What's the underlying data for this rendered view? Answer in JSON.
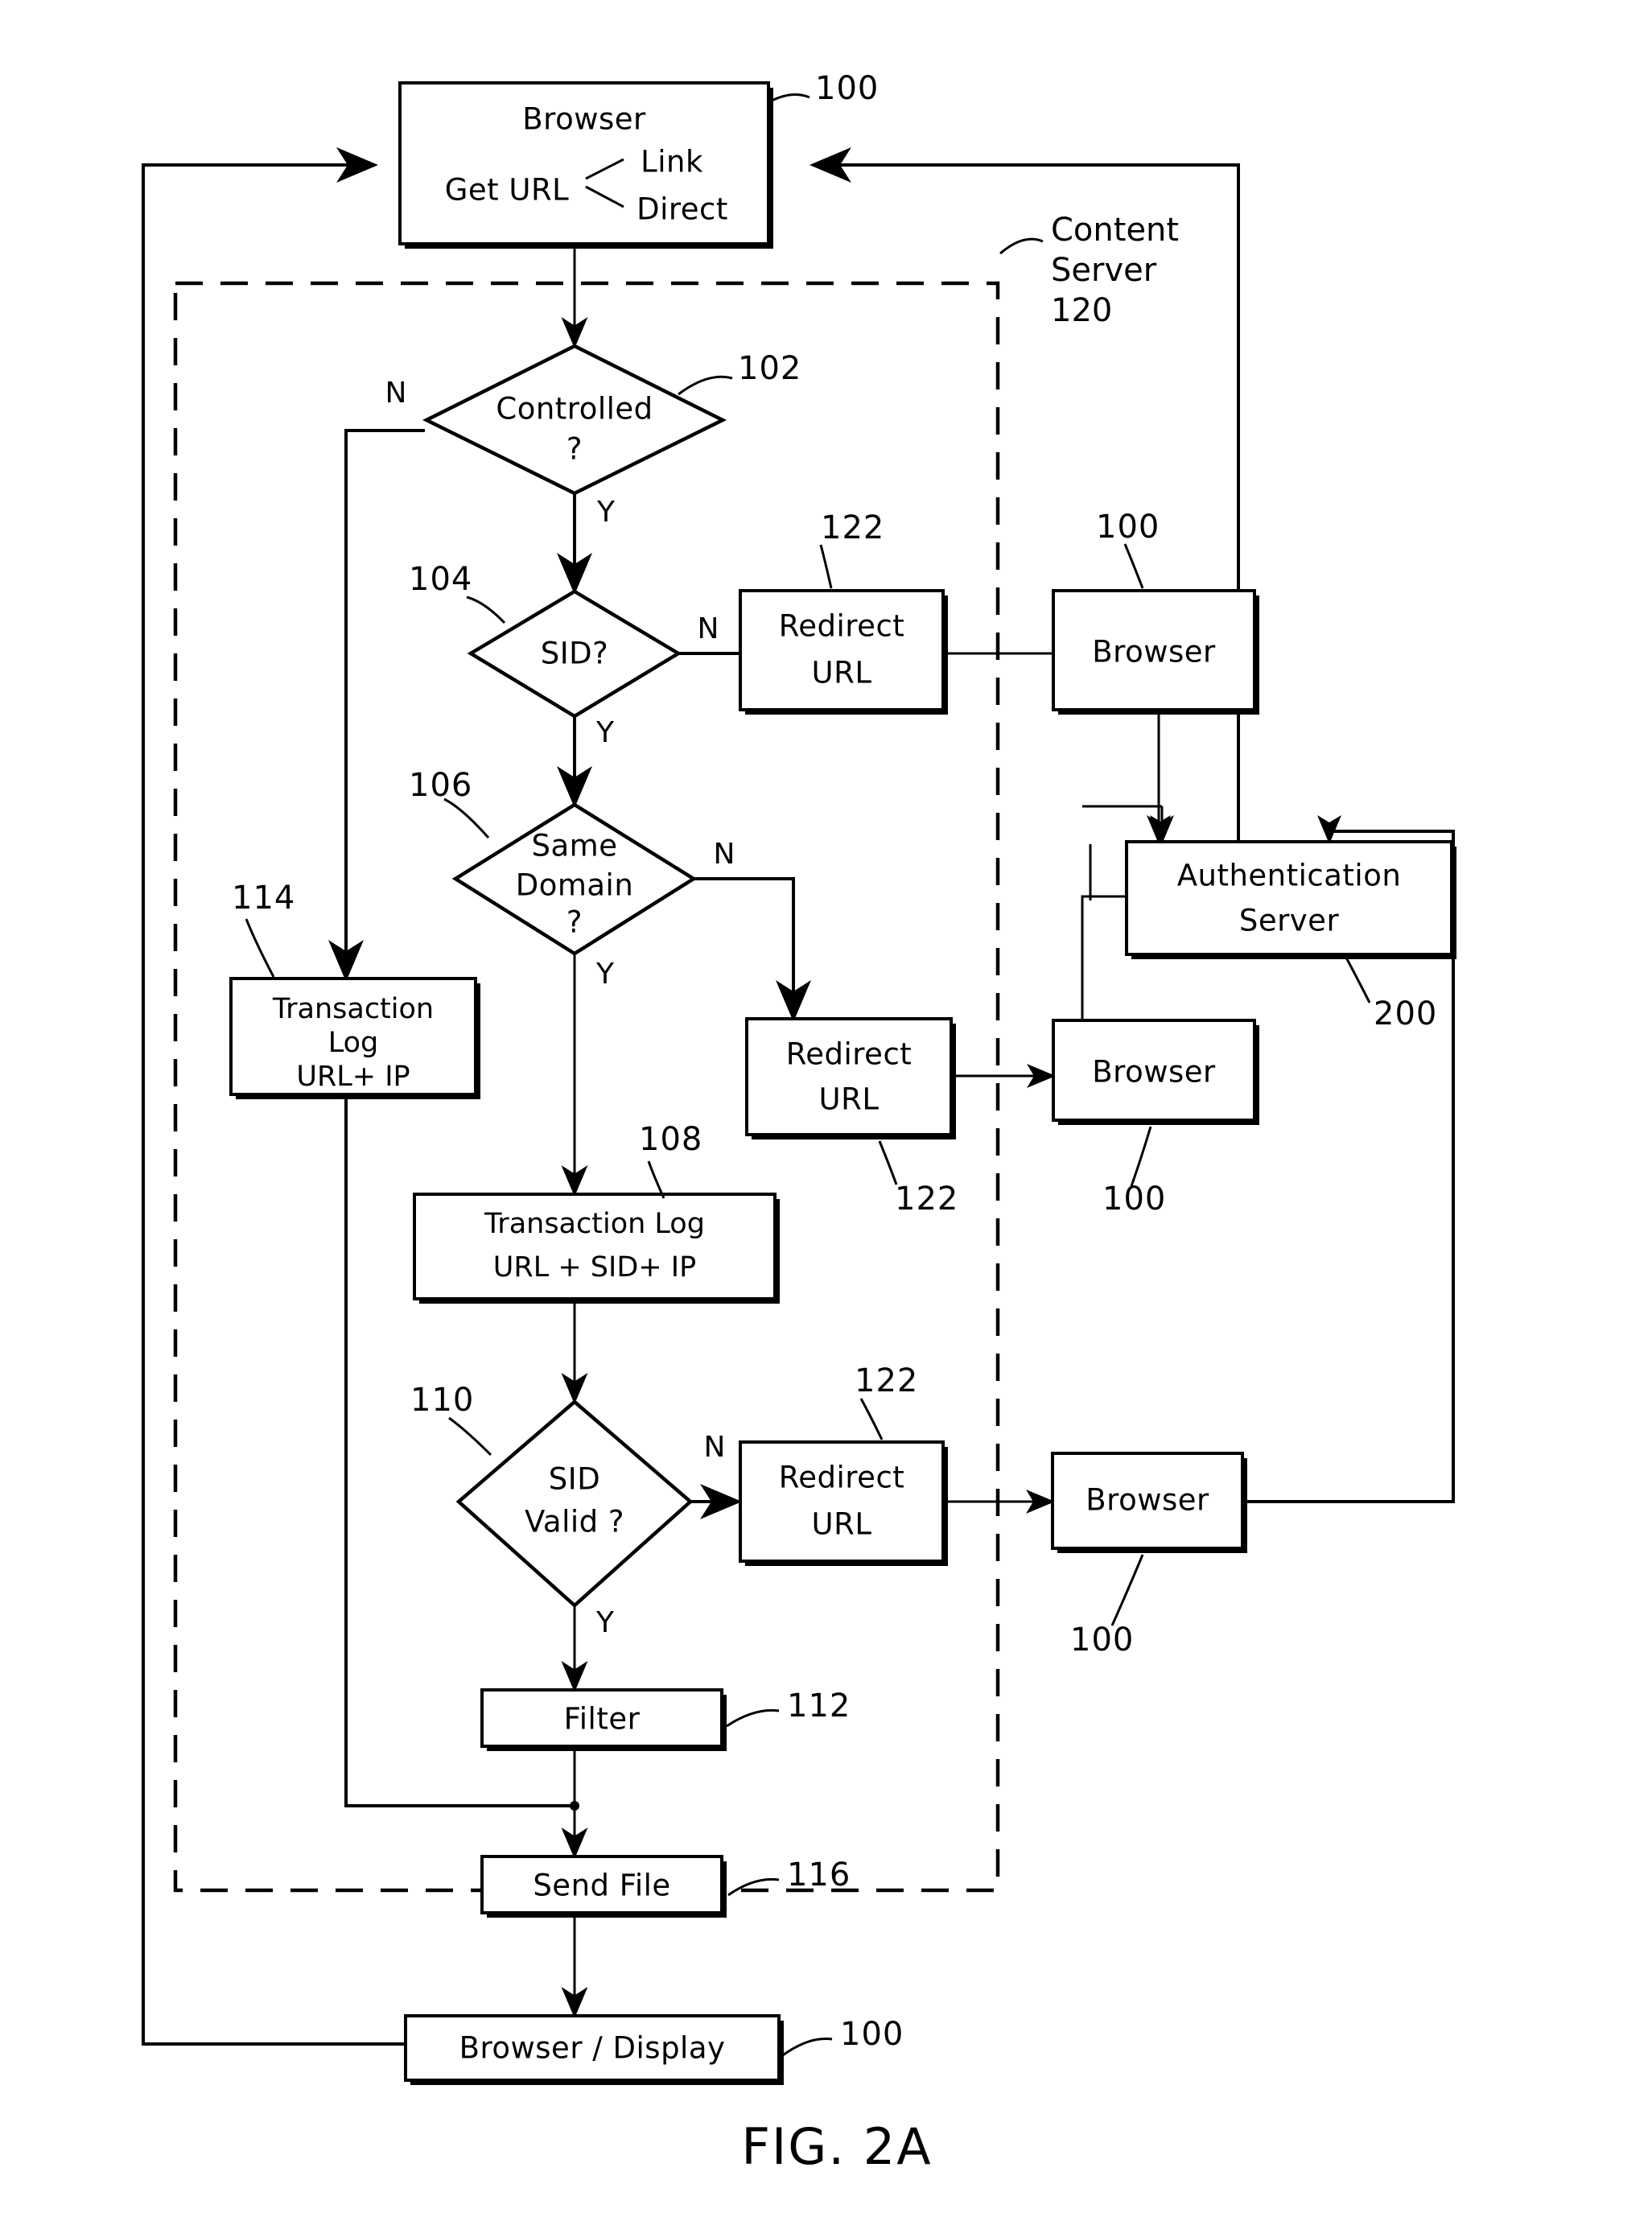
{
  "figure": {
    "caption": "FIG. 2A"
  },
  "groups": [
    {
      "id": "content-server",
      "name_line1": "Content",
      "name_line2": "Server",
      "ref": "120"
    }
  ],
  "nodes": {
    "browser_top": {
      "title": "Browser",
      "action": "Get URL",
      "option1": "Link",
      "option2": "Direct",
      "ref": "100"
    },
    "controlled": {
      "label_line1": "Controlled",
      "label_line2": "?",
      "ref": "102",
      "yes": "Y",
      "no": "N"
    },
    "sid": {
      "label_line1": "SID?",
      "ref": "104",
      "yes": "Y",
      "no": "N"
    },
    "same_domain": {
      "label_line1": "Same",
      "label_line2": "Domain",
      "label_line3": "?",
      "ref": "106",
      "yes": "Y",
      "no": "N"
    },
    "txlog_114": {
      "line1": "Transaction",
      "line2": "Log",
      "line3": "URL+ IP",
      "ref": "114"
    },
    "txlog_108": {
      "line1": "Transaction Log",
      "line2": "URL + SID+ IP",
      "ref": "108"
    },
    "sid_valid": {
      "label_line1": "SID",
      "label_line2": "Valid ?",
      "ref": "110",
      "yes": "Y",
      "no": "N"
    },
    "filter": {
      "label": "Filter",
      "ref": "112"
    },
    "send_file": {
      "label": "Send File",
      "ref": "116"
    },
    "browser_display": {
      "label": "Browser / Display",
      "ref": "100"
    },
    "redirect_1": {
      "line1": "Redirect",
      "line2": "URL",
      "ref": "122"
    },
    "redirect_2": {
      "line1": "Redirect",
      "line2": "URL",
      "ref": "122"
    },
    "redirect_3": {
      "line1": "Redirect",
      "line2": "URL",
      "ref": "122"
    },
    "browser_1": {
      "label": "Browser",
      "ref": "100"
    },
    "browser_2": {
      "label": "Browser",
      "ref": "100"
    },
    "browser_3": {
      "label": "Browser",
      "ref": "100"
    },
    "auth_server": {
      "line1": "Authentication",
      "line2": "Server",
      "ref": "200"
    }
  }
}
